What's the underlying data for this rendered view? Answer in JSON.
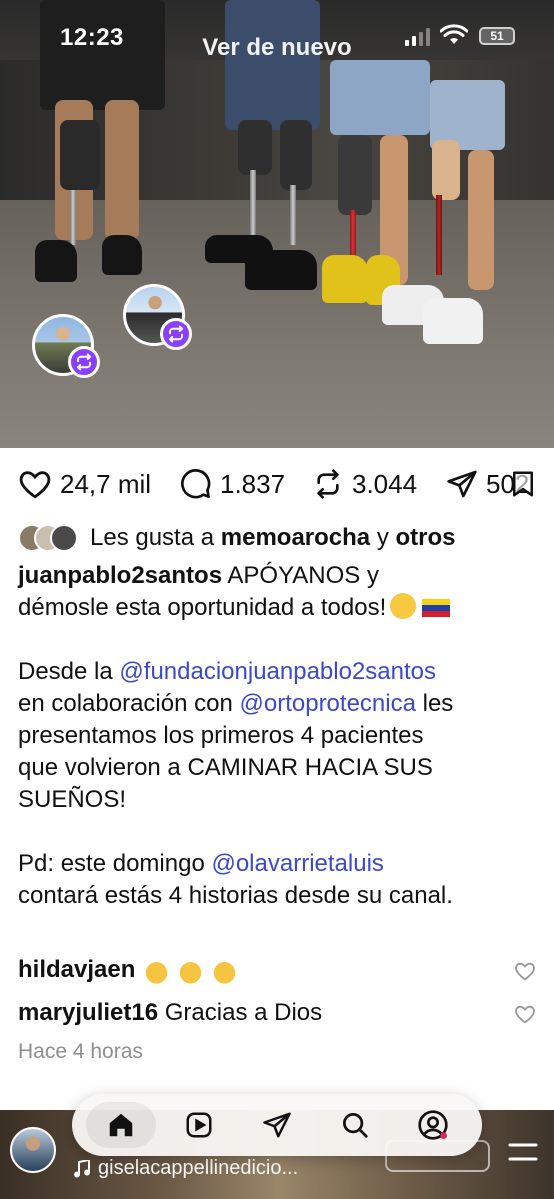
{
  "status_bar": {
    "time": "12:23",
    "battery": "51"
  },
  "photo": {
    "overlay_title": "Ver de nuevo"
  },
  "actions": {
    "likes": "24,7 mil",
    "comments": "1.837",
    "reposts": "3.044",
    "shares": "502"
  },
  "likes_line": {
    "prefix": "Les gusta a",
    "user": "memoarocha",
    "conj": "y",
    "others": "otros"
  },
  "caption": {
    "author": "juanpablo2santos",
    "line1_text": "APÓYANOS y",
    "line2": "démosle esta oportunidad a todos!",
    "line3_pre": "Desde la",
    "line3_mention": "@fundacionjuanpablo2santos",
    "line4_pre": "en colaboración con",
    "line4_mention": "@ortoprotecnica",
    "line4_post": "les",
    "line5": "presentamos los primeros 4 pacientes",
    "line6": "que volvieron a CAMINAR HACIA SUS",
    "line7": "SUEÑOS!",
    "line8_pre": "Pd: este domingo",
    "line8_mention": "@olavarrietaluis",
    "line9": "contará estás 4 historias desde su canal."
  },
  "comments": [
    {
      "user": "hildavjaen",
      "text": ""
    },
    {
      "user": "maryjuliet16",
      "text": "Gracias a Dios"
    }
  ],
  "timestamp": "Hace 4 horas",
  "bottom": {
    "music": "giselacappellinedicio..."
  },
  "colors": {
    "mention": "#3b49cc",
    "repost_badge": "#8a3ffc"
  },
  "icons": [
    "heart-icon",
    "comment-icon",
    "repost-icon",
    "share-icon",
    "bookmark-icon",
    "home-icon",
    "reels-icon",
    "send-icon",
    "search-icon",
    "profile-icon",
    "music-icon",
    "menu-icon"
  ]
}
